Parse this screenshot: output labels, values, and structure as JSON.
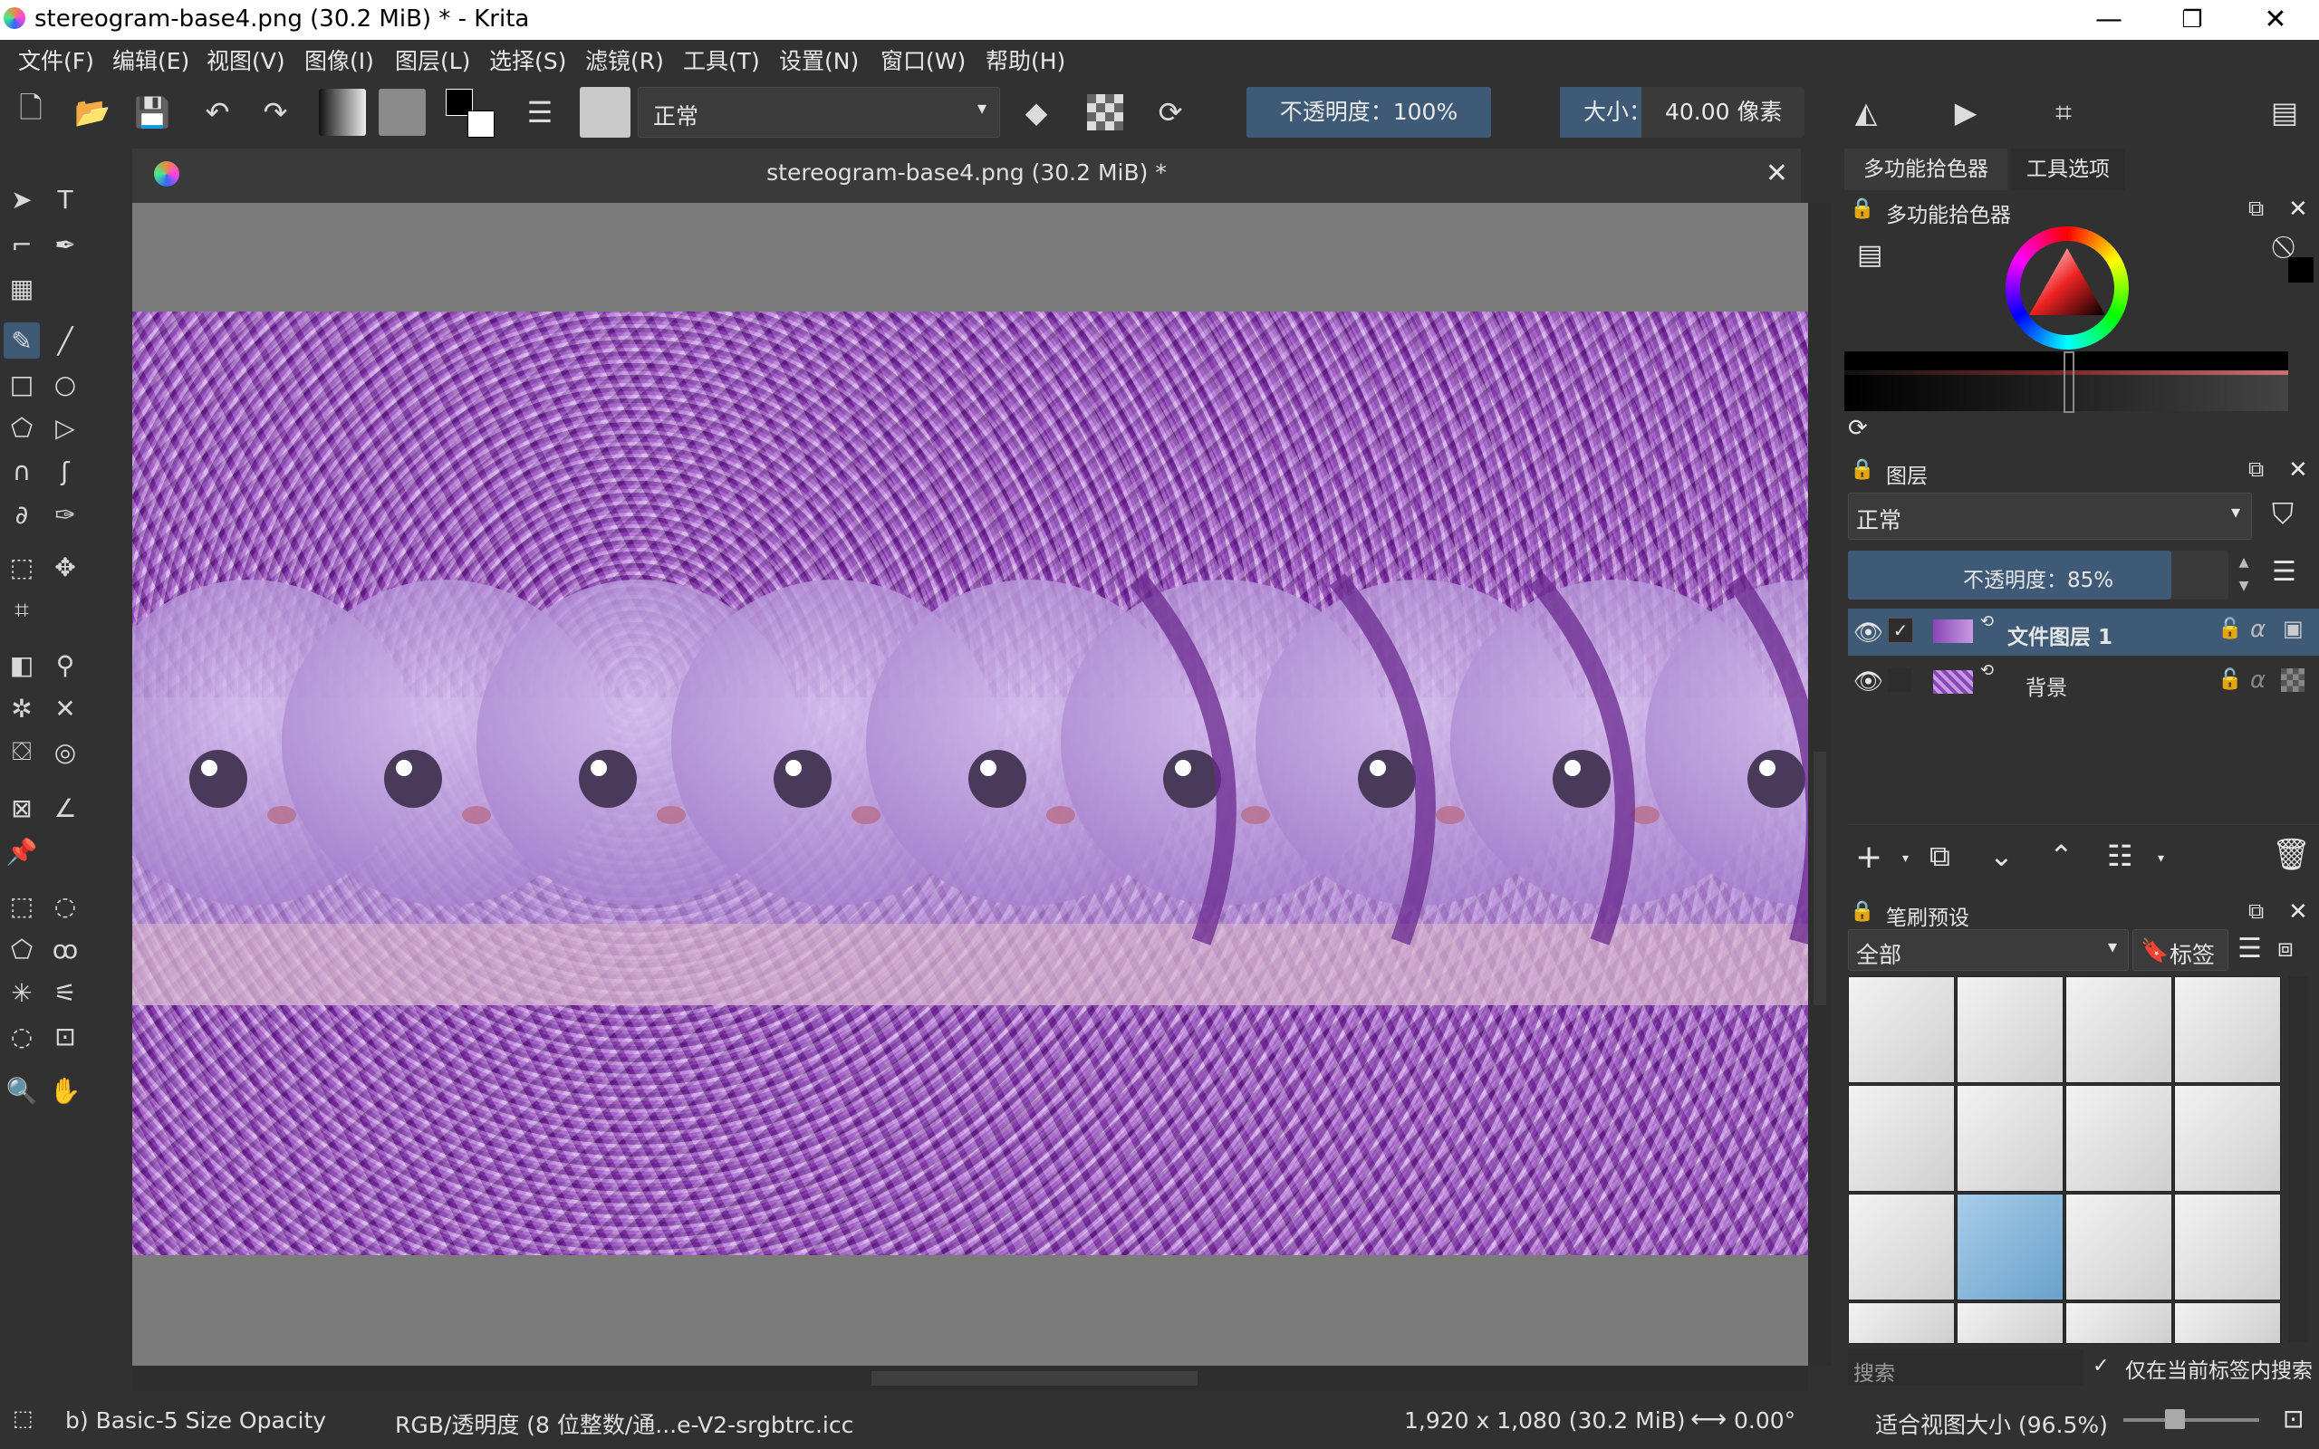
{
  "window": {
    "title": "stereogram-base4.png (30.2 MiB) * - Krita",
    "minimize": "—",
    "restore": "❐",
    "close": "✕"
  },
  "menubar": [
    "文件(F)",
    "编辑(E)",
    "视图(V)",
    "图像(I)",
    "图层(L)",
    "选择(S)",
    "滤镜(R)",
    "工具(T)",
    "设置(N)",
    "窗口(W)",
    "帮助(H)"
  ],
  "toolbar": {
    "blend_mode": "正常",
    "opacity": "不透明度：100%",
    "size_label": "大小：",
    "size_value": "40.00 像素"
  },
  "document": {
    "tab_title": "stereogram-base4.png (30.2 MiB) *"
  },
  "color_selector": {
    "tab": "多功能拾色器",
    "tab2": "工具选项",
    "panel_title": "多功能拾色器"
  },
  "layers": {
    "title": "图层",
    "blend_mode": "正常",
    "opacity": "不透明度：85%",
    "opacity_fraction": 0.85,
    "items": [
      {
        "name": "文件图层 1",
        "selected": true
      },
      {
        "name": "背景",
        "selected": false
      }
    ]
  },
  "brush_presets": {
    "title": "笔刷预设",
    "filter": "全部",
    "tag_button": "标签",
    "search_placeholder": "搜索",
    "only_in_tag": "仅在当前标签内搜索"
  },
  "status": {
    "brush": "b) Basic-5 Size Opacity",
    "color_profile": "RGB/透明度 (8 位整数/通...e-V2-srgbtrc.icc",
    "dimensions": "1,920 x 1,080 (30.2 MiB)",
    "rotation": "0.00°",
    "zoom": "适合视图大小 (96.5%)"
  },
  "colors": {
    "accent": "#3f5a77",
    "background": "#313131",
    "image_purple": "#8a45b8"
  }
}
